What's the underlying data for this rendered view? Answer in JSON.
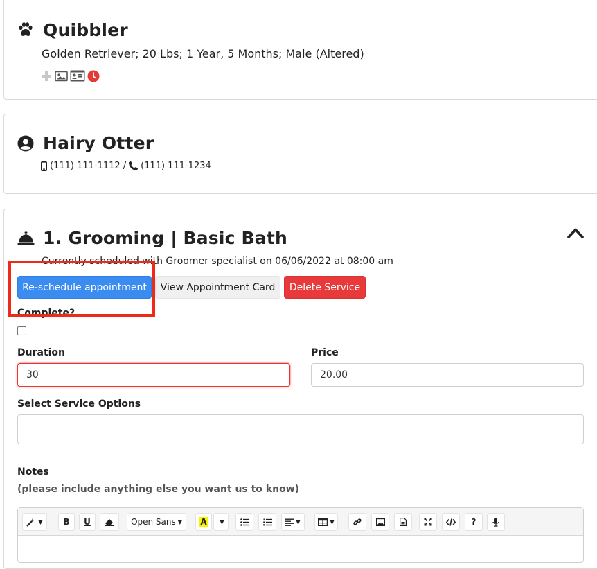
{
  "pet": {
    "name": "Quibbler",
    "details": "Golden Retriever; 20 Lbs; 1 Year, 5 Months; Male (Altered)",
    "icons": [
      "paw-icon",
      "plus-icon",
      "image-icon",
      "id-card-icon",
      "clock-icon"
    ]
  },
  "owner": {
    "name": "Hairy Otter",
    "mobile": "(111) 111-1112",
    "separator": "/",
    "phone": "(111) 111-1234",
    "icons": [
      "user-circle-icon",
      "mobile-icon",
      "phone-icon"
    ]
  },
  "service": {
    "title": "1. Grooming | Basic Bath",
    "schedule_text": "Currently scheduled with Groomer specialist on 06/06/2022 at 08:00 am",
    "reschedule_label": "Re-schedule appointment",
    "view_card_label": "View Appointment Card",
    "delete_label": "Delete Service",
    "complete_label": "Complete?",
    "duration_label": "Duration",
    "duration_value": "30",
    "price_label": "Price",
    "price_value": "20.00",
    "options_label": "Select Service Options",
    "notes_label": "Notes",
    "notes_hint": "(please include anything else you want us to know)",
    "icons": [
      "bell-icon",
      "chevron-up-icon"
    ]
  },
  "editor": {
    "font_name": "Open Sans",
    "tools": [
      "magic-icon",
      "bold-icon",
      "underline-icon",
      "eraser-icon",
      "font-select",
      "font-color-icon",
      "color-dropdown",
      "unordered-list-icon",
      "ordered-list-icon",
      "align-icon",
      "table-icon",
      "link-icon",
      "picture-icon",
      "file-icon",
      "fullscreen-icon",
      "code-icon",
      "help-icon",
      "microphone-icon"
    ],
    "bold_glyph": "B",
    "underline_glyph": "U",
    "font_color_glyph": "A",
    "help_glyph": "?"
  },
  "colors": {
    "primary": "#3b8cf0",
    "danger": "#e83a3a",
    "clock": "#e53935",
    "highlight": "#ee2b1a"
  }
}
